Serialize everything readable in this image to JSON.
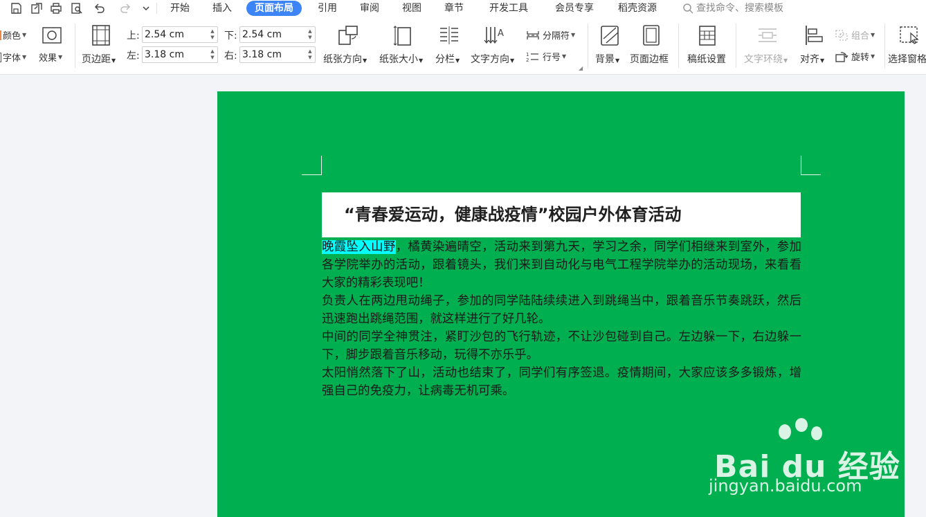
{
  "menu": {
    "tabs": [
      "开始",
      "插入",
      "页面布局",
      "引用",
      "审阅",
      "视图",
      "章节",
      "开发工具",
      "会员专享",
      "稻壳资源"
    ],
    "active_tab": "页面布局",
    "search_placeholder": "查找命令、搜索模板"
  },
  "ribbon": {
    "color_label": "颜色",
    "font_label": "字体",
    "effect_label": "效果",
    "margins_label": "页边距",
    "top_label": "上:",
    "top_value": "2.54 cm",
    "bottom_label": "下:",
    "bottom_value": "2.54 cm",
    "left_label": "左:",
    "left_value": "3.18 cm",
    "right_label": "右:",
    "right_value": "3.18 cm",
    "orientation_label": "纸张方向",
    "size_label": "纸张大小",
    "columns_label": "分栏",
    "text_direction_label": "文字方向",
    "separator_label": "分隔符",
    "line_number_label": "行号",
    "background_label": "背景",
    "page_border_label": "页面边框",
    "manuscript_label": "稿纸设置",
    "text_wrap_label": "文字环绕",
    "align_label": "对齐",
    "group_label": "组合",
    "rotate_label": "旋转",
    "selection_pane_label": "选择窗格"
  },
  "document": {
    "title": "“青春爱运动，健康战疫情”校园户外体育活动",
    "highlighted": "晚霞坠入山野",
    "para1_rest": "，橘黄染遍晴空，活动来到第九天，学习之余，同学们相继来到室外，参加各学院举办的活动，跟着镜头，我们来到自动化与电气工程学院举办的活动现场，来看看大家的精彩表现吧！",
    "para2": "负责人在两边甩动绳子，参加的同学陆陆续续进入到跳绳当中，跟着音乐节奏跳跃，然后迅速跑出跳绳范围，就这样进行了好几轮。",
    "para3": "中间的同学全神贯注，紧盯沙包的飞行轨迹，不让沙包碰到自己。左边躲一下，右边躲一下，脚步跟着音乐移动，玩得不亦乐乎。",
    "para4": "太阳悄然落下了山，活动也结束了，同学们有序签退。疫情期间，大家应该多多锻炼，增强自己的免疫力，让病毒无机可乘。",
    "page_color": "#00af50",
    "highlight_color": "#00ffff"
  },
  "watermark": {
    "brand": "Bai du 经验",
    "url": "jingyan.baidu.com"
  }
}
